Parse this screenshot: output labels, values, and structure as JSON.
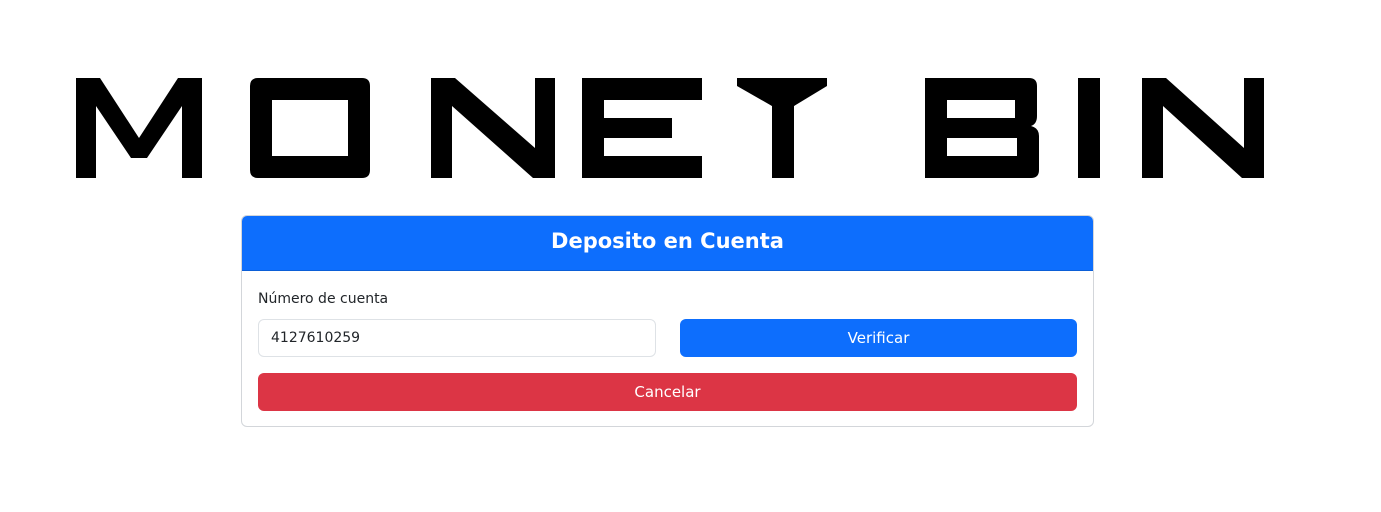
{
  "logo": {
    "text": "MONEY BIN"
  },
  "deposit_form": {
    "title": "Deposito en Cuenta",
    "account_label": "Número de cuenta",
    "account_value": "4127610259",
    "verify_label": "Verificar",
    "cancel_label": "Cancelar"
  },
  "colors": {
    "primary": "#0d6efd",
    "danger": "#dc3545",
    "text": "#212529",
    "logo": "#000000"
  }
}
